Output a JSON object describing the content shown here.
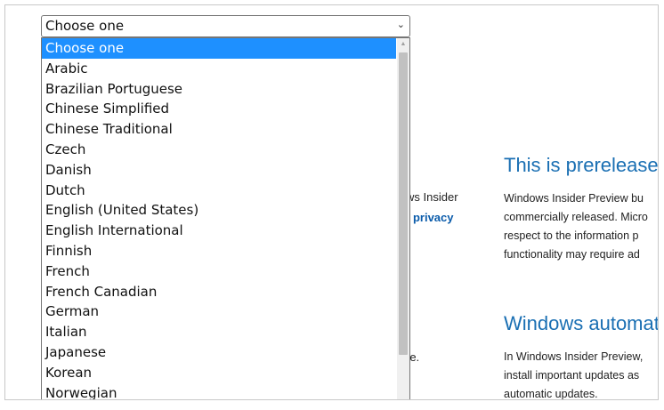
{
  "select": {
    "value": "Choose one",
    "chevron": "⌄"
  },
  "options": [
    "Choose one",
    "Arabic",
    "Brazilian Portuguese",
    "Chinese Simplified",
    "Chinese Traditional",
    "Czech",
    "Danish",
    "Dutch",
    "English (United States)",
    "English International",
    "Finnish",
    "French",
    "French Canadian",
    "German",
    "Italian",
    "Japanese",
    "Korean",
    "Norwegian"
  ],
  "selected_index": 0,
  "background": {
    "left_fragment_1": "ws Insider",
    "left_fragment_2_prefix": "r ",
    "left_fragment_2_link": "privacy",
    "left_fragment_3": "re.",
    "section1": {
      "heading": "This is prerelease s",
      "lines": [
        "Windows Insider Preview bu",
        "commercially released. Micro",
        "respect to the information p",
        "functionality may require ad"
      ]
    },
    "section2": {
      "heading": "Windows automat",
      "lines": [
        "In Windows Insider Preview,",
        "install important updates as",
        "automatic updates."
      ]
    }
  },
  "colors": {
    "selected_bg": "#1e90ff",
    "heading": "#1a6fb3",
    "link": "#0b5cab"
  }
}
